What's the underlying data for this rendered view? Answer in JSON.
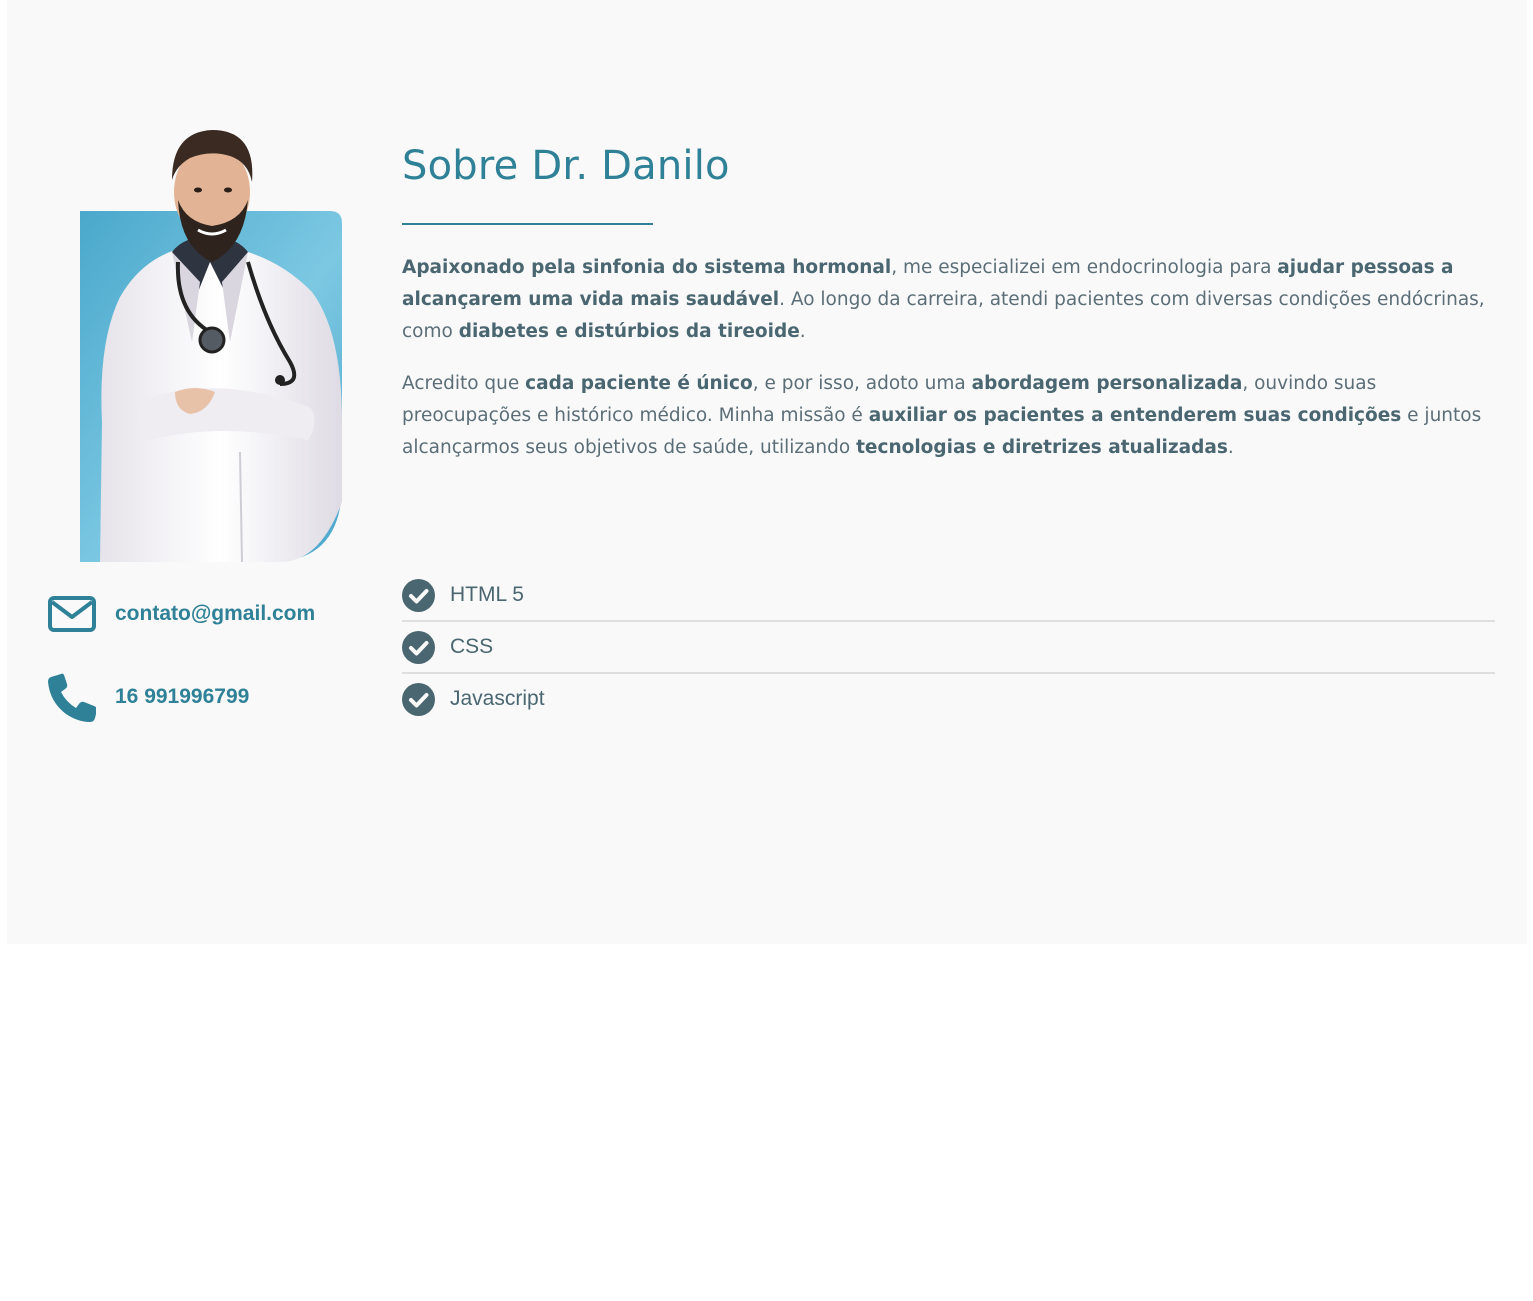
{
  "about": {
    "title": "Sobre Dr. Danilo",
    "photo_alt": "Dr. Danilo",
    "bio_paragraphs": [
      [
        {
          "text": "Apaixonado pela sinfonia do sistema hormonal",
          "bold": true
        },
        {
          "text": ", me especializei em endocrinologia para ",
          "bold": false
        },
        {
          "text": "ajudar pessoas a alcançarem uma vida mais saudável",
          "bold": true
        },
        {
          "text": ". Ao longo da carreira, atendi pacientes com diversas condições endócrinas, como ",
          "bold": false
        },
        {
          "text": "diabetes e distúrbios da tireoide",
          "bold": true
        },
        {
          "text": ".",
          "bold": false
        }
      ],
      [
        {
          "text": "Acredito que ",
          "bold": false
        },
        {
          "text": "cada paciente é único",
          "bold": true
        },
        {
          "text": ", e por isso, adoto uma ",
          "bold": false
        },
        {
          "text": "abordagem personalizada",
          "bold": true
        },
        {
          "text": ", ouvindo suas preocupações e histórico médico. Minha missão é ",
          "bold": false
        },
        {
          "text": "auxiliar os pacientes a entenderem suas condições",
          "bold": true
        },
        {
          "text": " e juntos alcançarmos seus objetivos de saúde, utilizando ",
          "bold": false
        },
        {
          "text": "tecnologias e diretrizes atualizadas",
          "bold": true
        },
        {
          "text": ".",
          "bold": false
        }
      ]
    ],
    "skills": [
      "HTML 5",
      "CSS",
      "Javascript"
    ]
  },
  "contact": {
    "email": "contato@gmail.com",
    "phone": "16 991996799"
  },
  "icons": {
    "email": "envelope-icon",
    "phone": "phone-icon",
    "check": "check-circle-icon"
  },
  "colors": {
    "accent": "#2e8196",
    "text": "#5b6e77",
    "text_bold": "#4a6670",
    "check": "#4a6670",
    "photo_bg": "#5ab4d3",
    "section_bg": "#f9f9f9"
  }
}
